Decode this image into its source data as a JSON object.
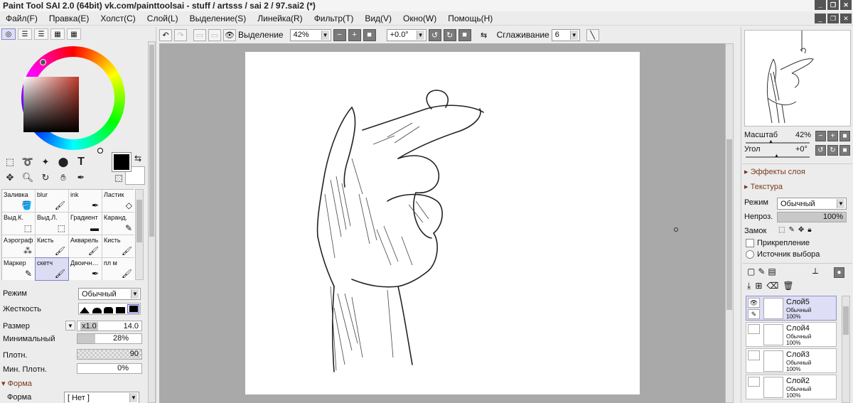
{
  "window": {
    "title": "Paint Tool SAI 2.0 (64bit) vk.com/painttoolsai - stuff / artsss / sai 2 / 97.sai2 (*)"
  },
  "menu": [
    "Файл(F)",
    "Правка(E)",
    "Холст(C)",
    "Слой(L)",
    "Выделение(S)",
    "Линейка(R)",
    "Фильтр(T)",
    "Вид(V)",
    "Окно(W)",
    "Помощь(H)"
  ],
  "toolbar": {
    "selection_label": "Выделение",
    "zoom": "42%",
    "rotation": "+0.0°",
    "smoothing_label": "Сглаживание",
    "smoothing_value": "6"
  },
  "tools": {
    "text_tool": "T"
  },
  "brushes": [
    {
      "label": "Заливка",
      "icon": "bucket"
    },
    {
      "label": "blur",
      "icon": "brush"
    },
    {
      "label": "ink",
      "icon": "pen"
    },
    {
      "label": "Ластик",
      "icon": "eraser"
    },
    {
      "label": "Выд.К.",
      "icon": "select"
    },
    {
      "label": "Выд.Л.",
      "icon": "select"
    },
    {
      "label": "Градиент",
      "icon": "gradient"
    },
    {
      "label": "Каранд.",
      "icon": "pencil"
    },
    {
      "label": "Аэрограф",
      "icon": "spray"
    },
    {
      "label": "Кисть",
      "icon": "brush"
    },
    {
      "label": "Акварель",
      "icon": "brush"
    },
    {
      "label": "Кисть",
      "icon": "brush"
    },
    {
      "label": "Маркер",
      "icon": "pencil"
    },
    {
      "label": "скетч",
      "icon": "brush",
      "selected": true
    },
    {
      "label": "Двоичн…",
      "icon": "pen"
    },
    {
      "label": "пл м",
      "icon": "brush"
    }
  ],
  "brush_props": {
    "mode_label": "Режим",
    "mode_value": "Обычный",
    "hardness_label": "Жесткость",
    "size_label": "Размер",
    "size_multiplier": "x1.0",
    "size_value": "14.0",
    "min_label": "Минимальный",
    "min_value": "28%",
    "min_fraction": 0.28,
    "density_label": "Плотн.",
    "density_value": "90",
    "min_density_label": "Мин. Плотн.",
    "min_density_value": "0%",
    "shape_section": "Форма",
    "shape_label": "Форма",
    "shape_value": "[ Нет ]"
  },
  "navigator": {
    "scale_label": "Масштаб",
    "scale_value": "42%",
    "angle_label": "Угол",
    "angle_value": "+0°"
  },
  "layer_panel": {
    "effects_label": "Эффекты слоя",
    "texture_label": "Текстура",
    "mode_label": "Режим",
    "mode_value": "Обычный",
    "opacity_label": "Непроз.",
    "opacity_value": "100%",
    "lock_label": "Замок",
    "clip_label": "Прикрепление",
    "source_label": "Источник выбора",
    "layers": [
      {
        "name": "Слой5",
        "mode": "Обычный",
        "opacity": "100%",
        "selected": true
      },
      {
        "name": "Слой4",
        "mode": "Обычный",
        "opacity": "100%"
      },
      {
        "name": "Слой3",
        "mode": "Обычный",
        "opacity": "100%"
      },
      {
        "name": "Слой2",
        "mode": "Обычный",
        "opacity": "100%"
      }
    ]
  }
}
